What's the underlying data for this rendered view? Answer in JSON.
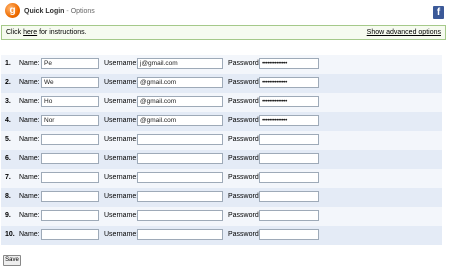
{
  "header": {
    "app_title": "Quick Login",
    "separator": " - ",
    "subtitle": "Options",
    "logo_icon": "g"
  },
  "info": {
    "prefix": "Click ",
    "link": "here",
    "suffix": " for instructions.",
    "advanced_link": "Show advanced options"
  },
  "labels": {
    "name": "Name:",
    "username": "Username:",
    "password": "Password:"
  },
  "rows": [
    {
      "num": "1.",
      "name": "Pe",
      "username": "j@gmail.com",
      "password": "••••••••••••••"
    },
    {
      "num": "2.",
      "name": "We",
      "username": "@gmail.com",
      "password": "••••••••••••••"
    },
    {
      "num": "3.",
      "name": "Ho",
      "username": "@gmail.com",
      "password": "••••••••••••••"
    },
    {
      "num": "4.",
      "name": "Nor",
      "username": "@gmail.com",
      "password": "••••••••••••••"
    },
    {
      "num": "5.",
      "name": "",
      "username": "",
      "password": ""
    },
    {
      "num": "6.",
      "name": "",
      "username": "",
      "password": ""
    },
    {
      "num": "7.",
      "name": "",
      "username": "",
      "password": ""
    },
    {
      "num": "8.",
      "name": "",
      "username": "",
      "password": ""
    },
    {
      "num": "9.",
      "name": "",
      "username": "",
      "password": ""
    },
    {
      "num": "10.",
      "name": "",
      "username": "",
      "password": ""
    }
  ],
  "save_label": "Save",
  "colors": {
    "row_odd": "#f3f6fb",
    "row_even": "#e4ebf6",
    "info_bg": "#f6fbf0",
    "info_border": "#a5c98a",
    "facebook": "#3b5998"
  }
}
